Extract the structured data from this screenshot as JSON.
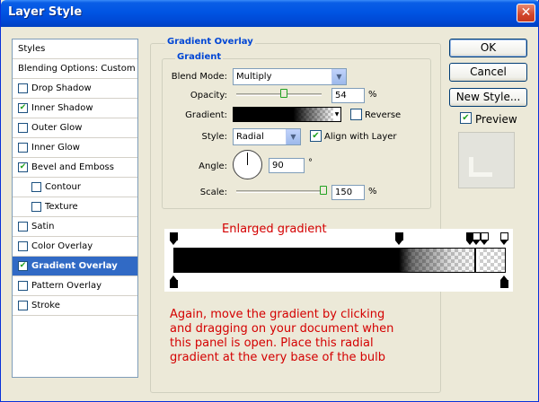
{
  "window": {
    "title": "Layer Style"
  },
  "styles_list": {
    "header": "Styles",
    "blending": "Blending Options: Custom",
    "items": [
      {
        "label": "Drop Shadow",
        "checked": false
      },
      {
        "label": "Inner Shadow",
        "checked": true
      },
      {
        "label": "Outer Glow",
        "checked": false
      },
      {
        "label": "Inner Glow",
        "checked": false
      },
      {
        "label": "Bevel and Emboss",
        "checked": true
      },
      {
        "label": "Contour",
        "checked": false
      },
      {
        "label": "Texture",
        "checked": false
      },
      {
        "label": "Satin",
        "checked": false
      },
      {
        "label": "Color Overlay",
        "checked": false
      },
      {
        "label": "Gradient Overlay",
        "checked": true
      },
      {
        "label": "Pattern Overlay",
        "checked": false
      },
      {
        "label": "Stroke",
        "checked": false
      }
    ]
  },
  "panel": {
    "group_title": "Gradient Overlay",
    "sub_title": "Gradient",
    "blend_mode_label": "Blend Mode:",
    "blend_mode_value": "Multiply",
    "opacity_label": "Opacity:",
    "opacity_value": "54",
    "opacity_unit": "%",
    "gradient_label": "Gradient:",
    "reverse_label": "Reverse",
    "style_label": "Style:",
    "style_value": "Radial",
    "align_label": "Align with Layer",
    "angle_label": "Angle:",
    "angle_value": "90",
    "angle_unit": "°",
    "scale_label": "Scale:",
    "scale_value": "150",
    "scale_unit": "%"
  },
  "buttons": {
    "ok": "OK",
    "cancel": "Cancel",
    "new_style": "New Style...",
    "preview": "Preview"
  },
  "annotation": {
    "title": "Enlarged gradient",
    "lines": [
      "Again, move the gradient by clicking",
      "and dragging on your document when",
      "this panel is open. Place this radial",
      "gradient at the very base of the bulb"
    ]
  },
  "colors": {
    "accent": "#0046d5",
    "selection": "#316ac5",
    "annotation": "#d40000"
  }
}
